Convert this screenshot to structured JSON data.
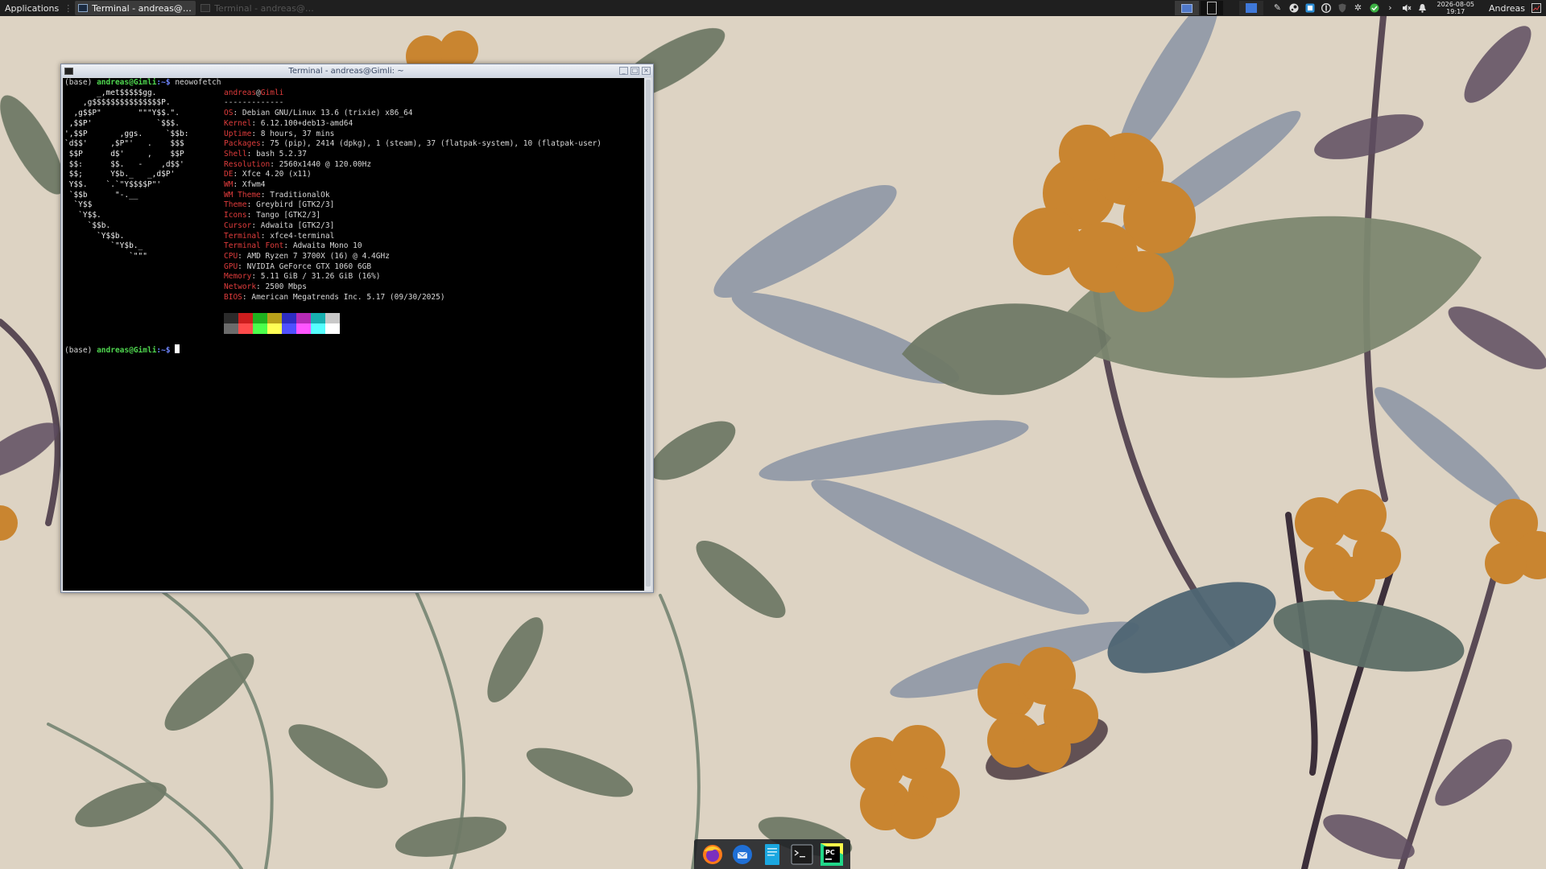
{
  "top_panel": {
    "applications_label": "Applications",
    "tasks": [
      {
        "label": "Terminal - andreas@Gim...",
        "active": true
      },
      {
        "label": "Terminal - andreas@Gim...",
        "active": false
      }
    ],
    "clock": {
      "date": "2026-08-05",
      "time": "19:17"
    },
    "user": "Andreas",
    "tray_icons": [
      "pin-icon",
      "steam-icon",
      "window-icon",
      "vpn-icon",
      "shield-icon",
      "gear-icon",
      "check-icon",
      "chevron-right-icon",
      "volume-mute-icon",
      "bell-icon"
    ]
  },
  "terminal": {
    "title": "Terminal - andreas@Gimli: ~",
    "prompt": {
      "env": "(base)",
      "user_host": "andreas@Gimli",
      "path": ":~$"
    },
    "command": "neowofetch",
    "header": {
      "user": "andreas",
      "at": "@",
      "host": "Gimli",
      "separator": "-------------"
    },
    "info": [
      {
        "label": "OS",
        "value": "Debian GNU/Linux 13.6 (trixie) x86_64"
      },
      {
        "label": "Kernel",
        "value": "6.12.100+deb13-amd64"
      },
      {
        "label": "Uptime",
        "value": "8 hours, 37 mins"
      },
      {
        "label": "Packages",
        "value": "75 (pip), 2414 (dpkg), 1 (steam), 37 (flatpak-system), 10 (flatpak-user)"
      },
      {
        "label": "Shell",
        "value": "bash 5.2.37"
      },
      {
        "label": "Resolution",
        "value": "2560x1440 @ 120.00Hz"
      },
      {
        "label": "DE",
        "value": "Xfce 4.20 (x11)"
      },
      {
        "label": "WM",
        "value": "Xfwm4"
      },
      {
        "label": "WM Theme",
        "value": "TraditionalOk"
      },
      {
        "label": "Theme",
        "value": "Greybird [GTK2/3]"
      },
      {
        "label": "Icons",
        "value": "Tango [GTK2/3]"
      },
      {
        "label": "Cursor",
        "value": "Adwaita [GTK2/3]"
      },
      {
        "label": "Terminal",
        "value": "xfce4-terminal"
      },
      {
        "label": "Terminal Font",
        "value": "Adwaita Mono 10"
      },
      {
        "label": "CPU",
        "value": "AMD Ryzen 7 3700X (16) @ 4.4GHz"
      },
      {
        "label": "GPU",
        "value": "NVIDIA GeForce GTX 1060 6GB"
      },
      {
        "label": "Memory",
        "value": "5.11 GiB / 31.26 GiB (16%)"
      },
      {
        "label": "Network",
        "value": "2500 Mbps"
      },
      {
        "label": "BIOS",
        "value": "American Megatrends Inc. 5.17 (09/30/2025)"
      }
    ],
    "ascii_logo": "       _,met$$$$$gg.\n    ,g$$$$$$$$$$$$$$$P.\n  ,g$$P\"        \"\"\"Y$$.\".\n ,$$P'              `$$$.\n',$$P       ,ggs.     `$$b:\n`d$$'     ,$P\"'   .    $$$\n $$P      d$'     ,    $$P\n $$:      $$.   -    ,d$$'\n $$;      Y$b._   _,d$P'\n Y$$.    `.`\"Y$$$$P\"'\n `$$b      \"-.__\n  `Y$$\n   `Y$$.\n     `$$b.\n       `Y$$b.\n          `\"Y$b._\n              `\"\"\"",
    "palette_top": [
      "#2b2b2b",
      "#cc1d1d",
      "#1fb11f",
      "#b8a11a",
      "#2d2dc2",
      "#b52bb5",
      "#18b0b0",
      "#c8c8c8"
    ],
    "palette_bottom": [
      "#6b6b6b",
      "#ff4b4b",
      "#4cff4c",
      "#ffff55",
      "#5050ff",
      "#ff55ff",
      "#55ffff",
      "#ffffff"
    ]
  },
  "dock": {
    "items": [
      "firefox-icon",
      "thunderbird-icon",
      "text-editor-icon",
      "terminal-icon",
      "pycharm-icon"
    ]
  }
}
